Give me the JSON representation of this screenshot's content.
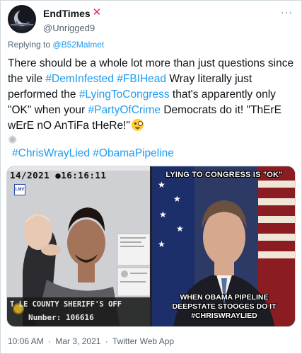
{
  "author": {
    "display_name": "EndTimes",
    "verified_mark": "✕",
    "handle": "@Unrigged9",
    "avatar_icon": "crescent-silhouette-avatar"
  },
  "menu": {
    "more_label": "···"
  },
  "reply": {
    "prefix": "Replying to",
    "to": "@B52Malmet"
  },
  "tweet": {
    "seg1": "There should be a whole lot more than just questions since the vile ",
    "tag1": "#DemInfested",
    "seg2": " ",
    "tag2": "#FBIHead",
    "seg3": " Wray literally just performed the ",
    "tag3": "#LyingToCongress",
    "seg4": " that's apparently only \"OK\" when your ",
    "tag4": "#PartyOfCrime",
    "seg5": " Democrats do it!  \"ThErE wErE nO AnTiFa tHeRe!\"",
    "tag5": "#ChrisWrayLied",
    "tag6": "#ObamaPipeline",
    "emoji_names": [
      "zany-face-emoji",
      "anger-burst-emoji"
    ]
  },
  "media": {
    "left": {
      "stamp": "14/2021 ●16:16:11",
      "logo": "LMV",
      "county_text": "T  LE COUNTY SHERIFF'S OFF",
      "number_text": "Number: 106616"
    },
    "right": {
      "top_caption": "LYING TO CONGRESS IS \"OK\"",
      "bottom_line1": "WHEN OBAMA PIPELINE",
      "bottom_line2": "DEEPSTATE STOOGES DO IT",
      "bottom_line3": "#CHRISWRAYLIED"
    }
  },
  "footer": {
    "time": "10:06 AM",
    "dot1": "·",
    "date": "Mar 3, 2021",
    "dot2": "·",
    "source": "Twitter Web App"
  },
  "colors": {
    "link": "#1d9bf0",
    "text": "#0f1419",
    "muted": "#536471",
    "verified_x": "#e0245e"
  }
}
